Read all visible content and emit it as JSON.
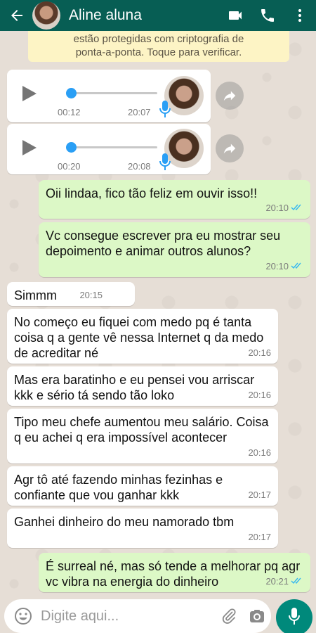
{
  "header": {
    "contact_name": "Aline aluna",
    "icons": [
      "back-arrow-icon",
      "video-call-icon",
      "phone-icon",
      "more-vert-icon"
    ]
  },
  "notice": {
    "line1": "estão protegidas com criptografia de",
    "line2": "ponta-a-ponta. Toque para verificar."
  },
  "audio_messages": [
    {
      "duration": "00:12",
      "time": "20:07",
      "progress": 0
    },
    {
      "duration": "00:20",
      "time": "20:08",
      "progress": 0
    }
  ],
  "messages": [
    {
      "direction": "out",
      "text": "Oii lindaa, fico tão feliz em ouvir isso!!",
      "time": "20:10",
      "status": "read"
    },
    {
      "direction": "out",
      "text": "Vc consegue escrever pra eu mostrar seu depoimento e animar outros alunos?",
      "time": "20:10",
      "status": "read"
    },
    {
      "direction": "in",
      "text": "Simmm",
      "time": "20:15"
    },
    {
      "direction": "in",
      "text": "No começo eu fiquei com medo pq é tanta coisa q a gente vê nessa Internet q da medo de acreditar né",
      "time": "20:16"
    },
    {
      "direction": "in",
      "text": "Mas era baratinho e eu pensei vou arriscar kkk e sério tá sendo tão loko",
      "time": "20:16"
    },
    {
      "direction": "in",
      "text": "Tipo meu chefe aumentou meu salário. Coisa q eu achei q era impossível acontecer",
      "time": "20:16"
    },
    {
      "direction": "in",
      "text": "Agr tô até fazendo minhas fezinhas e confiante que vou ganhar kkk",
      "time": "20:17"
    },
    {
      "direction": "in",
      "text": "Ganhei dinheiro do meu namorado tbm",
      "time": "20:17"
    },
    {
      "direction": "out",
      "text": "É surreal né, mas só tende a melhorar pq agr vc vibra na energia do dinheiro",
      "time": "20:21",
      "status": "read"
    }
  ],
  "footer": {
    "placeholder": "Digite aqui...",
    "icons": [
      "emoji-icon",
      "attach-icon",
      "camera-icon",
      "mic-icon"
    ]
  },
  "colors": {
    "header": "#075e54",
    "outgoing_bubble": "#dcf8c6",
    "incoming_bubble": "#ffffff",
    "read_ticks": "#34b7f1",
    "mic_button": "#00897b",
    "notice_bg": "#fdf4c5"
  }
}
